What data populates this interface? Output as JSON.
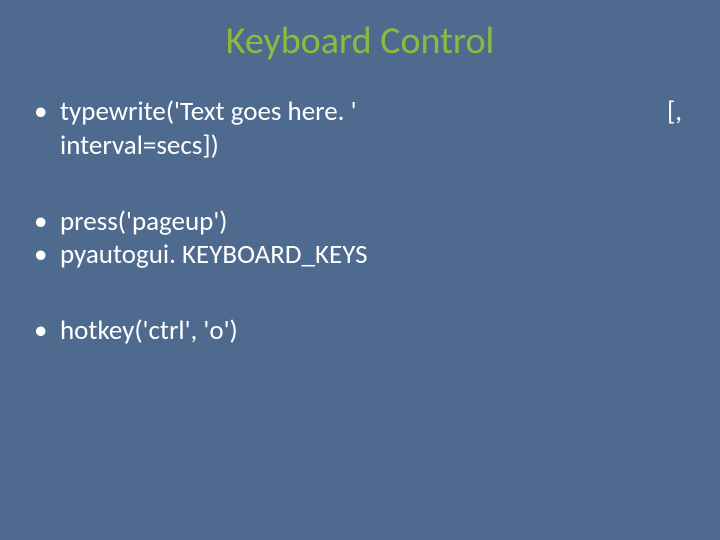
{
  "title": "Keyboard Control",
  "bullets": {
    "b1_line1_left": "typewrite('Text goes here. '",
    "b1_line1_right": "[,",
    "b1_line2": "interval=secs])",
    "b2": "press('pageup')",
    "b3": "pyautogui. KEYBOARD_KEYS",
    "b4": "hotkey('ctrl', 'o')"
  }
}
